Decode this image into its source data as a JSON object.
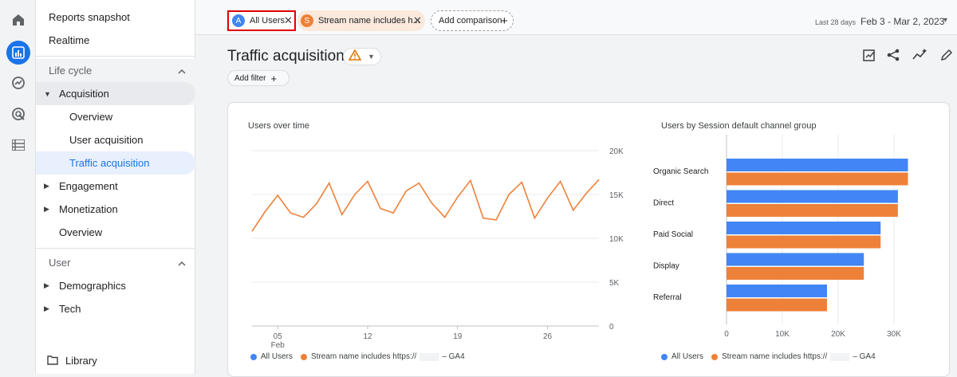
{
  "colors": {
    "blue": "#4285f4",
    "orange": "#ee8139",
    "accent": "#1a73e8",
    "warn": "#e37400",
    "highlight": "#e00000"
  },
  "rail": {
    "icons": [
      "home-icon",
      "reports-icon",
      "explore-icon",
      "advertising-icon",
      "configure-icon"
    ]
  },
  "nav": {
    "reports_snapshot": "Reports snapshot",
    "realtime": "Realtime",
    "lifecycle": "Life cycle",
    "acquisition": "Acquisition",
    "overview": "Overview",
    "user_acquisition": "User acquisition",
    "traffic_acquisition": "Traffic acquisition",
    "engagement": "Engagement",
    "monetization": "Monetization",
    "overview2": "Overview",
    "user": "User",
    "demographics": "Demographics",
    "tech": "Tech",
    "library": "Library"
  },
  "topbar": {
    "chip_all_users": {
      "badge": "A",
      "label": "All Users"
    },
    "chip_stream": {
      "badge": "S",
      "label": "Stream name includes h..."
    },
    "add_comparison": "Add comparison",
    "range_label": "Last 28 days",
    "range": "Feb 3 - Mar 2, 2023"
  },
  "page": {
    "title": "Traffic acquisition",
    "add_filter": "Add filter"
  },
  "users_over_time": {
    "title": "Users over time",
    "y_ticks": [
      "20K",
      "15K",
      "10K",
      "5K",
      "0"
    ],
    "x_ticks": [
      "05",
      "12",
      "19",
      "26"
    ],
    "x_sub": "Feb",
    "legend": {
      "all": "All Users",
      "stream_prefix": "Stream name includes https://",
      "stream_suffix": "– GA4"
    }
  },
  "by_channel": {
    "title": "Users by Session default channel group",
    "x_ticks": [
      "0",
      "10K",
      "20K",
      "30K"
    ],
    "legend": {
      "all": "All Users",
      "stream_prefix": "Stream name includes https://",
      "stream_suffix": "– GA4"
    }
  },
  "chart_data": [
    {
      "type": "line",
      "title": "Users over time",
      "ylim": [
        0,
        20000
      ],
      "x": [
        "Feb 3",
        "Feb 4",
        "Feb 5",
        "Feb 6",
        "Feb 7",
        "Feb 8",
        "Feb 9",
        "Feb 10",
        "Feb 11",
        "Feb 12",
        "Feb 13",
        "Feb 14",
        "Feb 15",
        "Feb 16",
        "Feb 17",
        "Feb 18",
        "Feb 19",
        "Feb 20",
        "Feb 21",
        "Feb 22",
        "Feb 23",
        "Feb 24",
        "Feb 25",
        "Feb 26",
        "Feb 27",
        "Feb 28",
        "Mar 1",
        "Mar 2"
      ],
      "series": [
        {
          "name": "Stream name includes https:// – GA4",
          "values": [
            10800,
            13000,
            14900,
            12900,
            12400,
            13900,
            16300,
            12700,
            15000,
            16500,
            13400,
            12900,
            15400,
            16300,
            14000,
            12400,
            14700,
            16600,
            12300,
            12100,
            15000,
            16400,
            12300,
            14600,
            16500,
            13200,
            15100,
            16700
          ]
        }
      ]
    },
    {
      "type": "bar",
      "title": "Users by Session default channel group",
      "categories": [
        "Organic Search",
        "Direct",
        "Paid Social",
        "Display",
        "Referral"
      ],
      "xlim": [
        0,
        32000
      ],
      "series": [
        {
          "name": "All Users",
          "values": [
            32500,
            30700,
            27600,
            24600,
            18000
          ]
        },
        {
          "name": "Stream name includes https:// – GA4",
          "values": [
            32500,
            30700,
            27600,
            24600,
            18000
          ]
        }
      ]
    }
  ]
}
